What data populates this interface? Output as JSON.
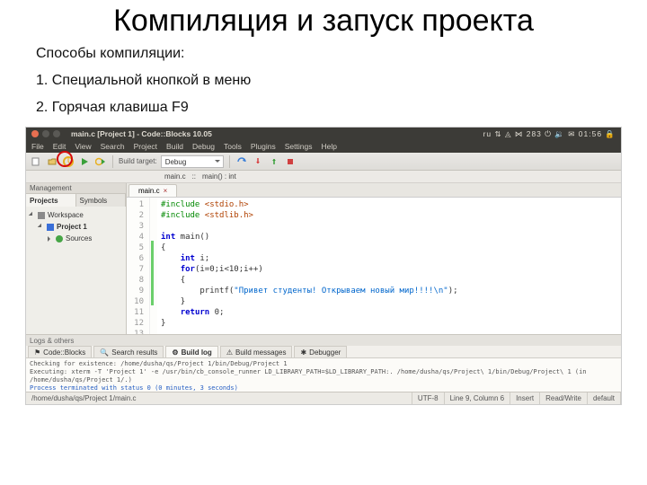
{
  "slide": {
    "title": "Компиляция и запуск проекта",
    "subtitle": "Способы компиляции:",
    "item1": "1. Специальной кнопкой в меню",
    "item2": "2. Горячая клавиша F9"
  },
  "titlebar": {
    "title": "main.c [Project 1] - Code::Blocks 10.05",
    "indicators": "ru  ⇅  ◬  ⋈  283  ⏻  🔉  ✉  01:56 🔒"
  },
  "menu": [
    "File",
    "Edit",
    "View",
    "Search",
    "Project",
    "Build",
    "Debug",
    "Tools",
    "Plugins",
    "Settings",
    "Help"
  ],
  "toolbar1": {
    "build_target_label": "Build target:",
    "build_target_value": "Debug"
  },
  "breadcrumb": {
    "file": "main.c",
    "scope": "main() : int"
  },
  "sidebar": {
    "header": "Management",
    "tabs": [
      "Projects",
      "Symbols"
    ],
    "workspace": "Workspace",
    "project": "Project 1",
    "sources": "Sources"
  },
  "editor": {
    "tab": "main.c",
    "gutter": [
      "1",
      "2",
      "3",
      "4",
      "5",
      "6",
      "7",
      "8",
      "9",
      "10",
      "11",
      "12",
      "13"
    ],
    "code": {
      "l1_pp": "#include",
      "l1_hdr": " <stdio.h>",
      "l2_pp": "#include",
      "l2_hdr": " <stdlib.h>",
      "l4_kw": "int",
      "l4_rest": " main()",
      "l5": "{",
      "l6_ind": "    ",
      "l6_kw": "int",
      "l6_rest": " i;",
      "l7_ind": "    ",
      "l7_kw": "for",
      "l7_rest": "(i=0;i<10;i++)",
      "l8_ind": "    ",
      "l8": "{",
      "l9_ind": "        ",
      "l9_call": "printf(",
      "l9_str": "\"Привет студенты! Открываем новый мир!!!!\\n\"",
      "l9_end": ");",
      "l10_ind": "    ",
      "l10": "}",
      "l11_ind": "    ",
      "l11_kw": "return",
      "l11_rest": " 0;",
      "l12": "}"
    }
  },
  "bottom": {
    "title": "Logs & others",
    "tabs": [
      "Code::Blocks",
      "Search results",
      "Build log",
      "Build messages",
      "Debugger"
    ],
    "log1": "Checking for existence: /home/dusha/qs/Project 1/bin/Debug/Project 1",
    "log2": "Executing: xterm -T 'Project 1' -e /usr/bin/cb_console_runner LD_LIBRARY_PATH=$LD_LIBRARY_PATH:. /home/dusha/qs/Project\\ 1/bin/Debug/Project\\ 1  (in /home/dusha/qs/Project 1/.)",
    "log3": "Process terminated with status 0 (0 minutes, 3 seconds)"
  },
  "status": {
    "path": "/home/dusha/qs/Project 1/main.c",
    "enc": "UTF-8",
    "pos": "Line 9, Column 6",
    "ins": "Insert",
    "rw": "Read/Write",
    "prof": "default"
  }
}
